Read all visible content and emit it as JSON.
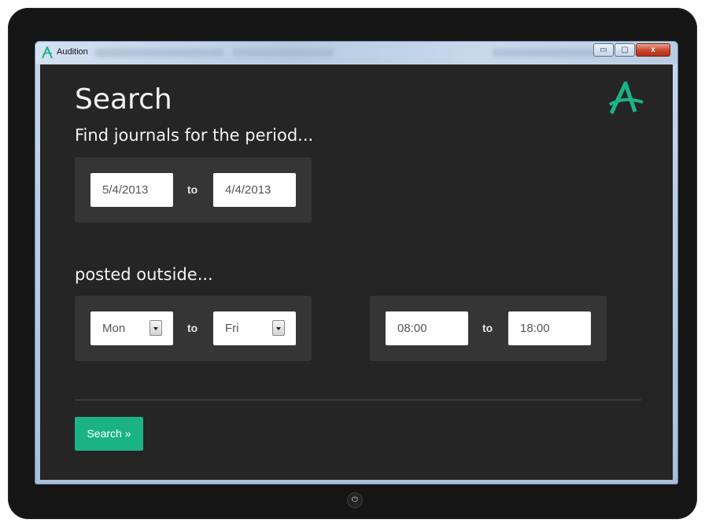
{
  "window": {
    "title": "Audition",
    "controls": {
      "minimize": "▭",
      "maximize": "▢",
      "close": "x"
    }
  },
  "colors": {
    "accent": "#1bb385",
    "background": "#252525",
    "panel": "#353535",
    "text": "#f2f2f2"
  },
  "page": {
    "title": "Search",
    "period_heading": "Find journals for the period...",
    "posted_heading": "posted outside..."
  },
  "period": {
    "from_date": "5/4/2013",
    "to_label": "to",
    "to_date": "4/4/2013"
  },
  "days": {
    "from_day": "Mon",
    "to_label": "to",
    "to_day": "Fri"
  },
  "times": {
    "from_time": "08:00",
    "to_label": "to",
    "to_time": "18:00"
  },
  "actions": {
    "search_label": "Search »"
  },
  "icons": {
    "app": "audition-logo-icon",
    "power": "power-icon",
    "dropdown": "chevron-down-icon"
  }
}
